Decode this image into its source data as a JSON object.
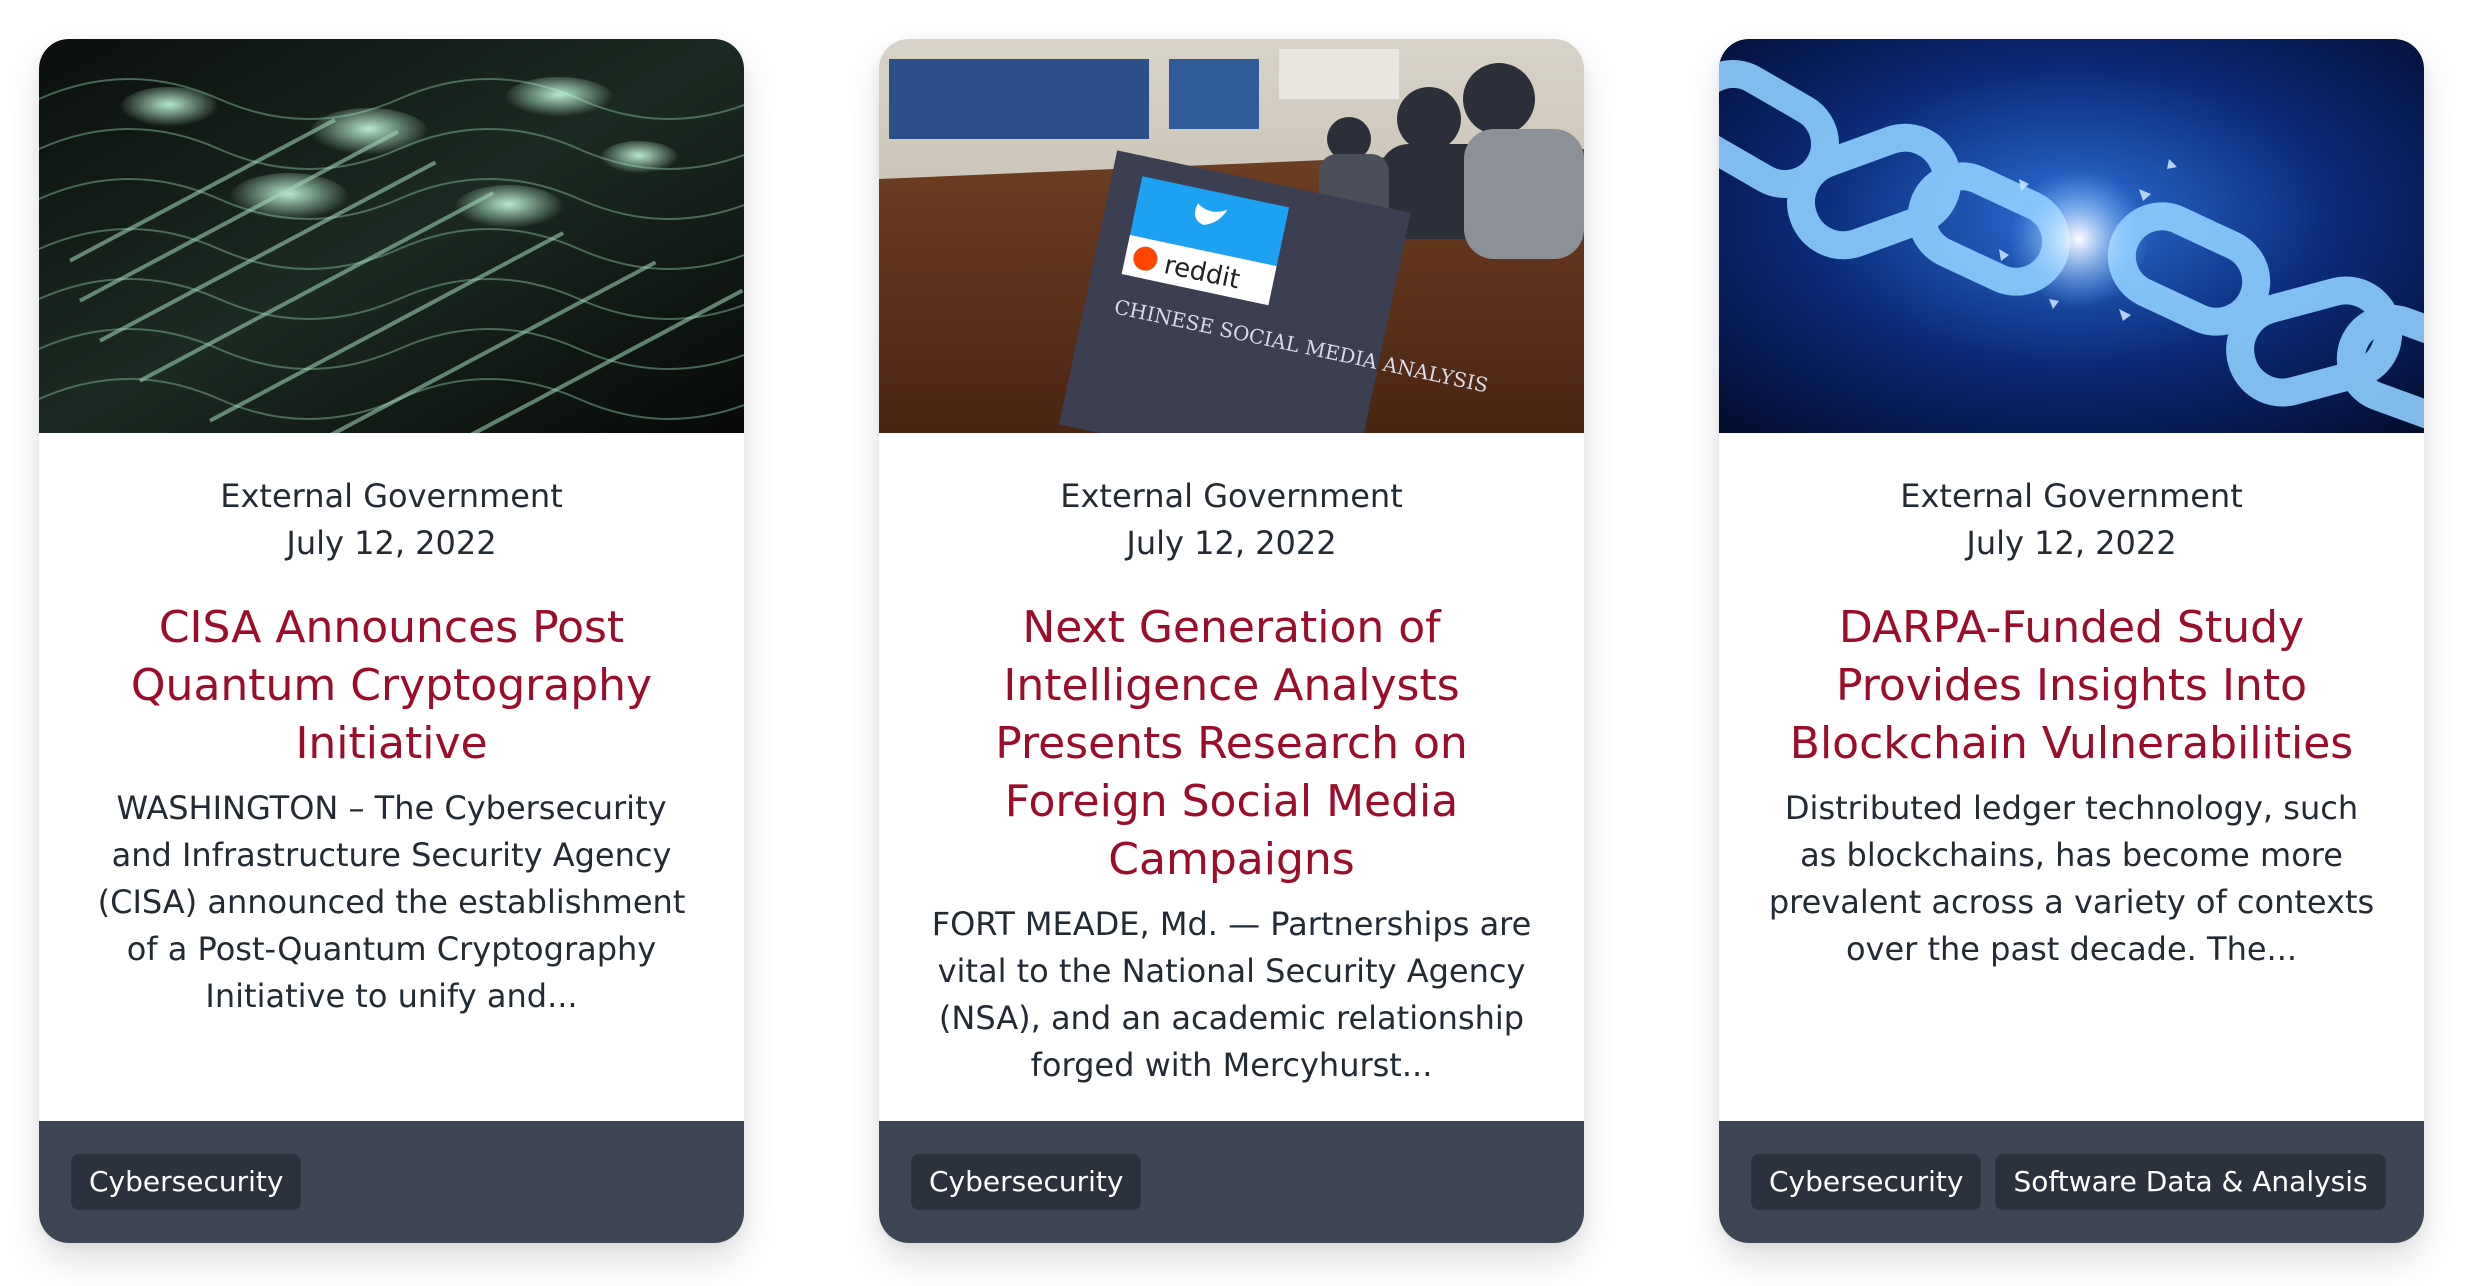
{
  "cards": [
    {
      "image_alt": "quantum cryptography code wave",
      "category": "External Government",
      "date": "July 12, 2022",
      "title": "CISA Announces Post Quantum Cryptography Initiative",
      "excerpt": "WASHINGTON – The Cybersecurity and Infrastructure Security Agency (CISA) announced the establishment of a Post-Quantum Cryptography Initiative to unify and...",
      "tags": [
        "Cybersecurity"
      ]
    },
    {
      "image_alt": "conference room with social media analysis document",
      "category": "External Government",
      "date": "July 12, 2022",
      "title": "Next Generation of Intelligence Analysts Presents Research on Foreign Social Media Campaigns",
      "excerpt": "FORT MEADE, Md. — Partnerships are vital to the National Security Agency (NSA), and an academic relationship forged with Mercyhurst...",
      "tags": [
        "Cybersecurity"
      ]
    },
    {
      "image_alt": "breaking blue chain",
      "category": "External Government",
      "date": "July 12, 2022",
      "title": "DARPA-Funded Study Provides Insights Into Blockchain Vulnerabilities",
      "excerpt": "Distributed ledger technology, such as blockchains, has become more prevalent across a variety of contexts over the past decade. The...",
      "tags": [
        "Cybersecurity",
        "Software Data & Analysis"
      ]
    }
  ],
  "image_text": {
    "doc_brand_1": "reddit",
    "doc_heading": "CHINESE SOCIAL MEDIA ANALYSIS"
  },
  "colors": {
    "title": "#9b0d2a",
    "text": "#222a33",
    "footer_bg": "#3e4554",
    "tag_bg": "#2b313d"
  }
}
